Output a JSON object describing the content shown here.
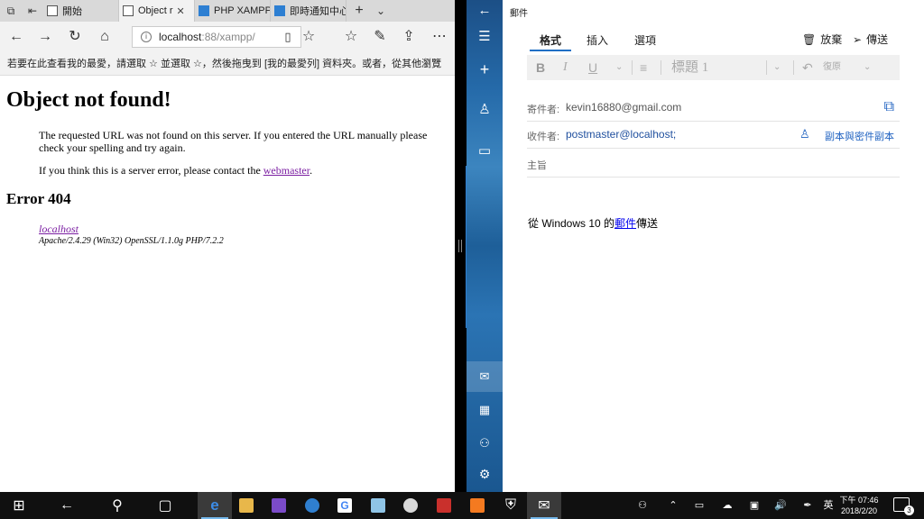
{
  "edge": {
    "tabs": [
      {
        "label": "開始",
        "icon": "page-icon"
      },
      {
        "label": "Object r",
        "icon": "page-icon"
      },
      {
        "label": "PHP XAMPP",
        "icon": "xampp-page-icon"
      },
      {
        "label": "即時通知中心",
        "icon": "xampp-page-icon"
      }
    ],
    "address": {
      "host": "localhost",
      "path": ":88/xampp/"
    },
    "favorites_hint": "若要在此查看我的最愛，請選取  ☆  並選取 ☆，然後拖曳到 [我的最愛列] 資料夾。或者，從其他瀏覽",
    "page": {
      "title": "Object not found!",
      "para1": "The requested URL was not found on this server. If you entered the URL manually please check your spelling and try again.",
      "para2_prefix": "If you think this is a server error, please contact the ",
      "para2_link": "webmaster",
      "para2_suffix": ".",
      "error_heading": "Error 404",
      "server_link": "localhost",
      "server_signature": "Apache/2.4.29 (Win32) OpenSSL/1.1.0g PHP/7.2.2"
    }
  },
  "mail": {
    "window_title": "郵件",
    "tabs": [
      "格式",
      "插入",
      "選項"
    ],
    "active_tab": "格式",
    "actions": {
      "discard": "放棄",
      "send": "傳送"
    },
    "format_bar": {
      "bold": "B",
      "italic": "I",
      "underline": "U",
      "style": "標題 1",
      "undo": "復原"
    },
    "from_label": "寄件者:",
    "from_value": "kevin16880@gmail.com",
    "to_label": "收件者:",
    "to_value": "postmaster@localhost;",
    "cc_bcc": "副本與密件副本",
    "subject_label": "主旨",
    "body_prefix": "從 Windows 10 的",
    "body_link": "郵件",
    "body_suffix": "傳送"
  },
  "taskbar": {
    "ime": "英",
    "time": "下午 07:46",
    "date": "2018/2/20",
    "notifications": "3"
  },
  "colors": {
    "accent": "#1f6fc5",
    "link_visited": "#7b1fa2",
    "mail_rail": "#256aa9"
  }
}
